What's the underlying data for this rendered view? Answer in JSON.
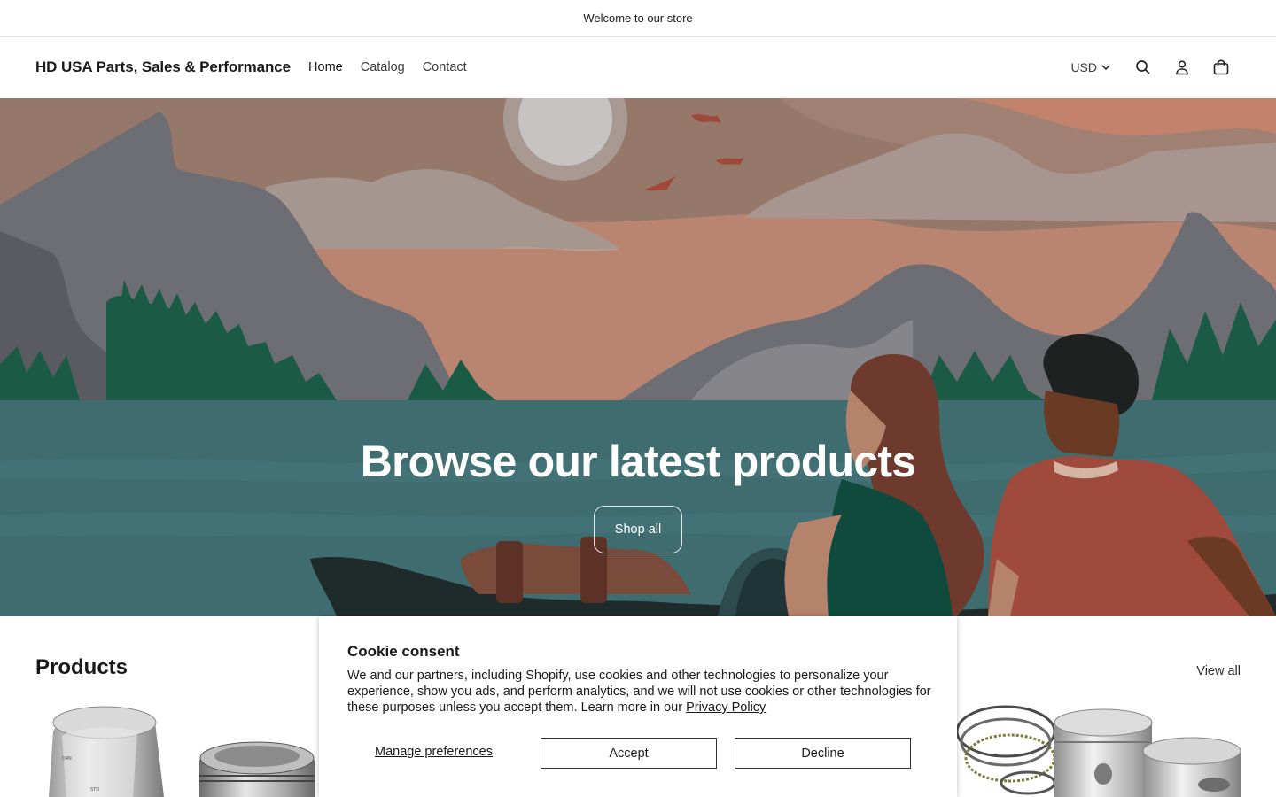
{
  "announcement": {
    "text": "Welcome to our store"
  },
  "header": {
    "brand": "HD USA Parts, Sales & Performance",
    "nav": [
      {
        "label": "Home"
      },
      {
        "label": "Catalog"
      },
      {
        "label": "Contact"
      }
    ],
    "currency": "USD",
    "icons": [
      "search-icon",
      "account-icon",
      "cart-icon"
    ]
  },
  "hero": {
    "title": "Browse our latest products",
    "button": "Shop all"
  },
  "products": {
    "title": "Products",
    "view_all": "View all"
  },
  "cookie": {
    "title": "Cookie consent",
    "text": "We and our partners, including Shopify, use cookies and other technologies to personalize your experience, show you ads, and perform analytics, and we will not use cookies or other technologies for these purposes unless you accept them. Learn more in our ",
    "link": "Privacy Policy",
    "manage": "Manage preferences",
    "accept": "Accept",
    "decline": "Decline"
  },
  "colors": {
    "sky": "#b98470",
    "water": "#3e6c6f",
    "trees": "#1b5a45",
    "mountain": "#6d6e73"
  }
}
